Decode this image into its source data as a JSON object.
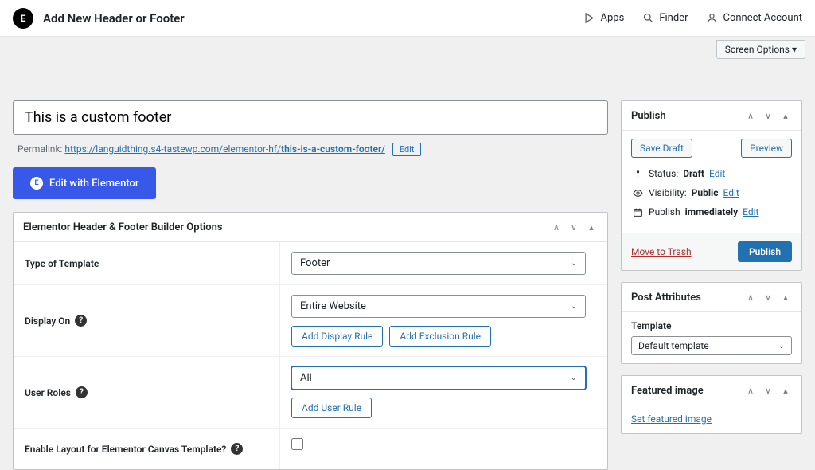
{
  "topbar": {
    "title": "Add New Header or Footer",
    "apps": "Apps",
    "finder": "Finder",
    "connect": "Connect Account",
    "logo": "E"
  },
  "screen_options": "Screen Options ▾",
  "title_value": "This is a custom footer",
  "permalink": {
    "label": "Permalink:",
    "base": "https://languidthing.s4-tastewp.com/elementor-hf/",
    "slug": "this-is-a-custom-footer/",
    "edit": "Edit"
  },
  "edit_elementor": "Edit with Elementor",
  "options_box": {
    "title": "Elementor Header & Footer Builder Options",
    "rows": {
      "type": {
        "label": "Type of Template",
        "value": "Footer"
      },
      "display": {
        "label": "Display On",
        "value": "Entire Website",
        "add_display": "Add Display Rule",
        "add_exclusion": "Add Exclusion Rule"
      },
      "roles": {
        "label": "User Roles",
        "value": "All",
        "add_user": "Add User Rule"
      },
      "canvas": {
        "label": "Enable Layout for Elementor Canvas Template?"
      }
    }
  },
  "publish": {
    "title": "Publish",
    "save_draft": "Save Draft",
    "preview": "Preview",
    "status_label": "Status:",
    "status_value": "Draft",
    "visibility_label": "Visibility:",
    "visibility_value": "Public",
    "publish_label": "Publish",
    "publish_value": "immediately",
    "edit": "Edit",
    "trash": "Move to Trash",
    "publish_btn": "Publish"
  },
  "attributes": {
    "title": "Post Attributes",
    "template_label": "Template",
    "template_value": "Default template"
  },
  "featured": {
    "title": "Featured image",
    "link": "Set featured image"
  }
}
